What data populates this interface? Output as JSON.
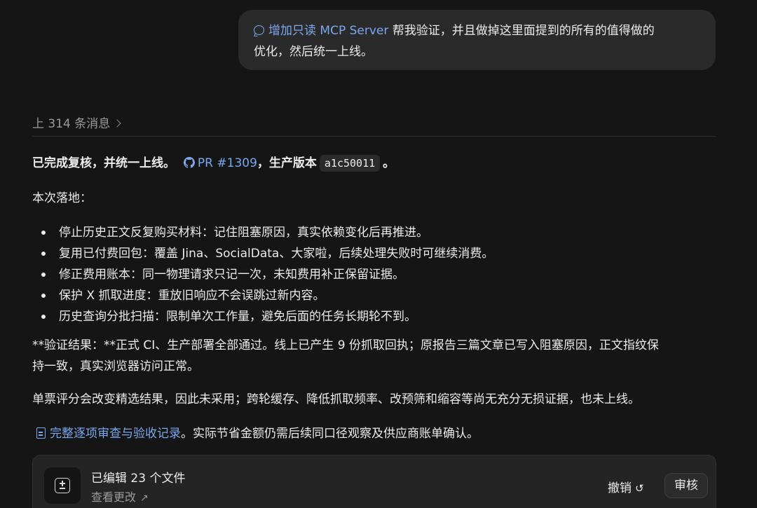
{
  "user_message": {
    "link_text": "增加只读 MCP Server",
    "text_line1": " 帮我验证，并且做掉这里面提到的所有的值得做的",
    "text_line2": "优化，然后统一上线。"
  },
  "prior_messages": {
    "label": "上 314 条消息"
  },
  "reply": {
    "p1_prefix": "已完成复核，并统一上线。",
    "pr_link": "PR #1309",
    "p1_mid": "，生产版本",
    "version": "a1c50011",
    "p1_suffix": "。",
    "p2": "本次落地：",
    "bullets": [
      "停止历史正文反复购买材料：记住阻塞原因，真实依赖变化后再推进。",
      "复用已付费回包：覆盖 Jina、SocialData、大家啦，后续处理失败时可继续消费。",
      "修正费用账本：同一物理请求只记一次，未知费用补正保留证据。",
      "保护 X 抓取进度：重放旧响应不会误跳过新内容。",
      "历史查询分批扫描：限制单次工作量，避免后面的任务长期轮不到。"
    ],
    "p3_line1": "**验证结果：**正式 CI、生产部署全部通过。线上已产生 9 份抓取回执；原报告三篇文章已写入阻塞原因，正文指纹保",
    "p3_line2": "持一致，真实浏览器访问正常。",
    "p4": "单票评分会改变精选结果，因此未采用；跨轮缓存、降低抓取频率、改预筛和缩容等尚无充分无损证据，也未上线。",
    "p5_link": "完整逐项审查与验收记录",
    "p5_suffix": "。实际节省金额仍需后续同口径观察及供应商账单确认。"
  },
  "files_card": {
    "title": "已编辑 23 个文件",
    "view_changes": "查看更改",
    "undo_label": "撤销",
    "review_label": "审核"
  },
  "colors": {
    "link": "#7aa7f0",
    "background": "#151515",
    "bubble": "#2a2a2a"
  }
}
